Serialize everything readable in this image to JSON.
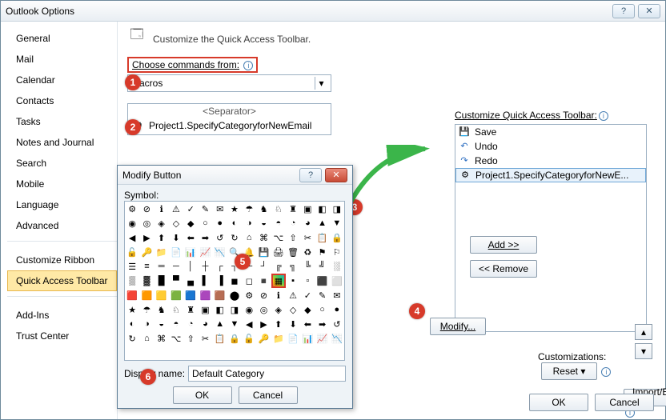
{
  "window": {
    "title": "Outlook Options"
  },
  "sidebar": {
    "items": [
      "General",
      "Mail",
      "Calendar",
      "Contacts",
      "Tasks",
      "Notes and Journal",
      "Search",
      "Mobile",
      "Language",
      "Advanced",
      "Customize Ribbon",
      "Quick Access Toolbar",
      "Add-Ins",
      "Trust Center"
    ],
    "selected_index": 11
  },
  "content": {
    "heading": "Customize the Quick Access Toolbar.",
    "choose_label": "Choose commands from:",
    "choose_value": "Macros",
    "separator_label": "<Separator>",
    "macro_item": "Project1.SpecifyCategoryforNewEmail",
    "qat_label": "Customize Quick Access Toolbar:",
    "qat_items": [
      {
        "icon": "💾",
        "label": "Save"
      },
      {
        "icon": "↶",
        "label": "Undo"
      },
      {
        "icon": "↷",
        "label": "Redo"
      },
      {
        "icon": "⚙",
        "label": "Project1.SpecifyCategoryforNewE..."
      }
    ],
    "add_label": "Add >>",
    "remove_label": "<< Remove",
    "modify_label": "Modify...",
    "cust_label": "Customizations:",
    "reset_label": "Reset ▾",
    "import_label": "Import/Export ▾",
    "ok_label": "OK",
    "cancel_label": "Cancel"
  },
  "dialog": {
    "title": "Modify Button",
    "symbol_label": "Symbol:",
    "display_label": "Display name:",
    "display_value": "Default Category",
    "ok_label": "OK",
    "cancel_label": "Cancel",
    "selected_row": 5,
    "selected_col": 10
  },
  "callouts": {
    "c1": "1",
    "c2": "2",
    "c3": "3",
    "c4": "4",
    "c5": "5",
    "c6": "6"
  },
  "colors": {
    "accent_red": "#d73a2a",
    "selection_yellow": "#ffe9a6"
  }
}
